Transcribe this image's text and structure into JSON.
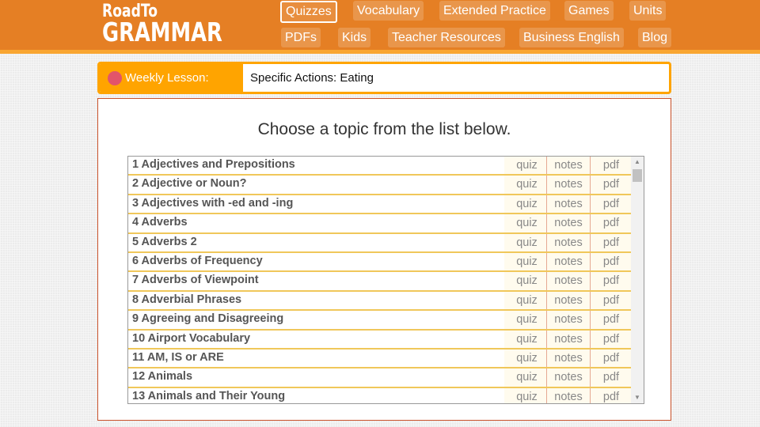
{
  "header": {
    "logo_line1": "RoadTo",
    "logo_line2": "GRAMMAR",
    "nav": [
      {
        "label": "Quizzes",
        "active": true
      },
      {
        "label": "Vocabulary"
      },
      {
        "label": "Extended Practice"
      },
      {
        "label": "Games"
      },
      {
        "label": "Units"
      },
      {
        "label": "PDFs"
      },
      {
        "label": "Kids"
      },
      {
        "label": "Teacher Resources"
      },
      {
        "label": "Business English"
      },
      {
        "label": "Blog"
      }
    ]
  },
  "weekly_lesson": {
    "label": "Weekly Lesson:",
    "value": "Specific Actions: Eating"
  },
  "main": {
    "heading": "Choose a topic from the list below.",
    "topics": [
      {
        "title": "1 Adjectives and Prepositions",
        "quiz": "quiz",
        "notes": "notes",
        "pdf": "pdf"
      },
      {
        "title": "2 Adjective or Noun?",
        "quiz": "quiz",
        "notes": "notes",
        "pdf": "pdf"
      },
      {
        "title": "3 Adjectives with -ed and -ing",
        "quiz": "quiz",
        "notes": "notes",
        "pdf": "pdf"
      },
      {
        "title": "4 Adverbs",
        "quiz": "quiz",
        "notes": "notes",
        "pdf": "pdf"
      },
      {
        "title": "5 Adverbs 2",
        "quiz": "quiz",
        "notes": "notes",
        "pdf": "pdf"
      },
      {
        "title": "6 Adverbs of Frequency",
        "quiz": "quiz",
        "notes": "notes",
        "pdf": "pdf"
      },
      {
        "title": "7 Adverbs of Viewpoint",
        "quiz": "quiz",
        "notes": "notes",
        "pdf": "pdf"
      },
      {
        "title": "8 Adverbial Phrases",
        "quiz": "quiz",
        "notes": "notes",
        "pdf": "pdf"
      },
      {
        "title": "9 Agreeing and Disagreeing",
        "quiz": "quiz",
        "notes": "notes",
        "pdf": "pdf"
      },
      {
        "title": "10 Airport Vocabulary",
        "quiz": "quiz",
        "notes": "notes",
        "pdf": "pdf"
      },
      {
        "title": "11 AM, IS or ARE",
        "quiz": "quiz",
        "notes": "notes",
        "pdf": "pdf"
      },
      {
        "title": "12 Animals",
        "quiz": "quiz",
        "notes": "notes",
        "pdf": "pdf"
      },
      {
        "title": "13 Animals and Their Young",
        "quiz": "quiz",
        "notes": "notes",
        "pdf": "pdf"
      }
    ],
    "scroll_up_icon": "▲",
    "scroll_down_icon": "▼"
  },
  "colors": {
    "header_bg": "#e57f24",
    "header_stripe": "#f9a632",
    "weekly_accent": "#ffa400",
    "weekly_dot": "#e2546a",
    "row_divider": "#f0c75a",
    "panel_border": "#c9512a"
  }
}
